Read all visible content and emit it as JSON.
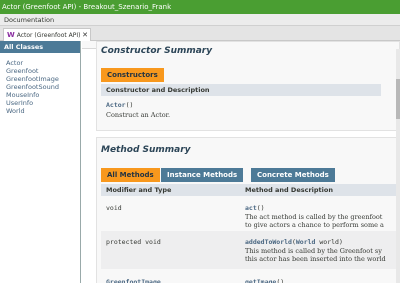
{
  "window": {
    "title": "Actor (Greenfoot API) - Breakout_Szenario_Frank"
  },
  "menu": {
    "documentation": "Documentation"
  },
  "tab": {
    "icon": "W",
    "label": "Actor (Greenfoot API)",
    "close": "✕"
  },
  "sidebar": {
    "heading": "All Classes",
    "items": [
      "Actor",
      "Greenfoot",
      "GreenfootImage",
      "GreenfootSound",
      "MouseInfo",
      "UserInfo",
      "World"
    ]
  },
  "constructor_summary": {
    "title": "Constructor Summary",
    "tab_label": "Constructors",
    "column_header": "Constructor and Description",
    "name": "Actor",
    "parens": "()",
    "description": "Construct an Actor."
  },
  "method_summary": {
    "title": "Method Summary",
    "tabs": [
      "All Methods",
      "Instance Methods",
      "Concrete Methods"
    ],
    "headers": {
      "modifier": "Modifier and Type",
      "method": "Method and Description"
    },
    "rows": [
      {
        "type": "void",
        "name": "act",
        "sig": "()",
        "desc1": "The act method is called by the greenfoot",
        "desc2": "to give actors a chance to perform some a"
      },
      {
        "type": "protected void",
        "name": "addedToWorld",
        "sig_open": "(",
        "param_type": "World",
        "sig_rest": " world)",
        "desc1": "This method is called by the Greenfoot sy",
        "desc2": "this actor has been inserted into the world"
      },
      {
        "type": "GreenfootImage",
        "name": "getImage",
        "sig": "()"
      }
    ]
  }
}
